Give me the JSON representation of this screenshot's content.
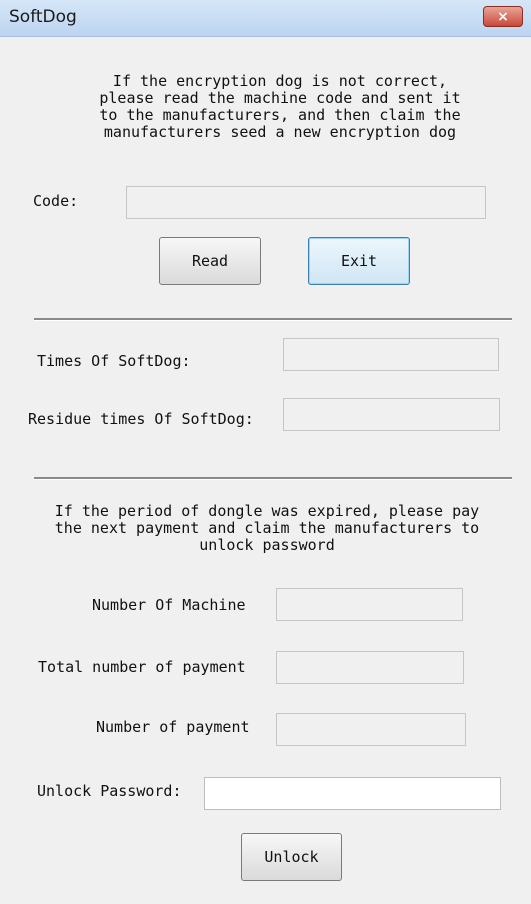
{
  "window": {
    "title": "SoftDog",
    "close_glyph": "×",
    "close_icon": "close-icon"
  },
  "encryption": {
    "notice": "If the encryption dog is not correct,\nplease read the machine code and sent it\nto the manufacturers, and then claim the\nmanufacturers seed a new encryption dog",
    "code_label": "Code:",
    "code_value": "",
    "read_label": "Read",
    "exit_label": "Exit"
  },
  "usage": {
    "times_label": "Times Of SoftDog:",
    "times_value": "",
    "residue_label": "Residue times Of SoftDog:",
    "residue_value": ""
  },
  "payment": {
    "notice": "If the period of dongle was expired, please pay\nthe next payment and claim the manufacturers to\nunlock password",
    "machine_label": "Number Of Machine",
    "machine_value": "",
    "total_label": "Total number of payment",
    "total_value": "",
    "number_label": "Number of payment",
    "number_value": "",
    "password_label": "Unlock Password:",
    "password_value": "",
    "unlock_label": "Unlock"
  }
}
